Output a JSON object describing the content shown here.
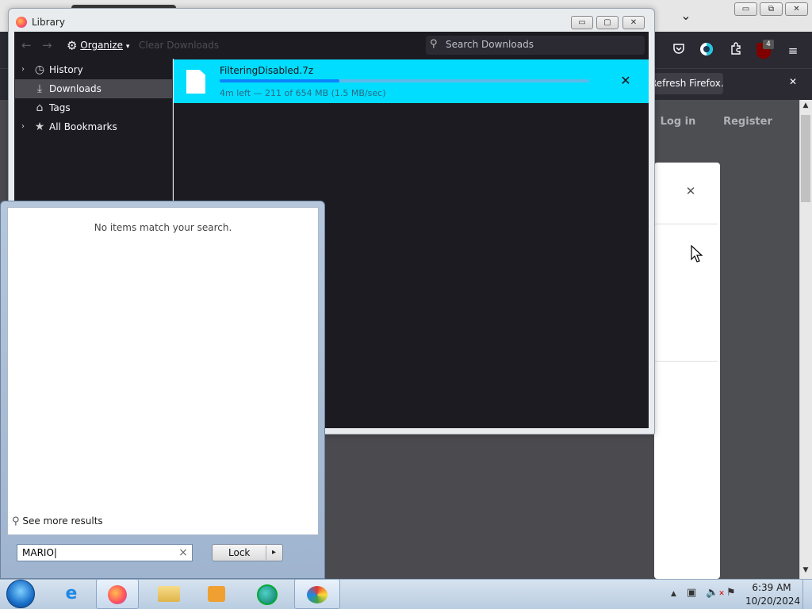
{
  "library": {
    "title": "Library",
    "organize_label": "Organize",
    "organize_arrow": "▾",
    "clear_label": "Clear Downloads",
    "search_placeholder": "Search Downloads",
    "sidebar": [
      {
        "label": "History",
        "icon": "clock-icon",
        "expander": "›"
      },
      {
        "label": "Downloads",
        "icon": "download-icon",
        "expander": ""
      },
      {
        "label": "Tags",
        "icon": "tag-icon",
        "expander": ""
      },
      {
        "label": "All Bookmarks",
        "icon": "star-icon",
        "expander": "›"
      }
    ],
    "download": {
      "filename": "FilteringDisabled.7z",
      "status": "4m left — 211 of 654 MB (1.5 MB/sec)",
      "progress": 0.323,
      "close_glyph": "✕"
    }
  },
  "firefox": {
    "notification_button": "Refresh Firefox…",
    "notification_close": "✕",
    "login_label": "Log in",
    "register_label": "Register",
    "dialog_close": "✕",
    "tabs_dropdown": "⌄",
    "extension_badge": "4"
  },
  "start_menu": {
    "no_results": "No items match your search.",
    "see_more": "See more results",
    "search_value": "MARIO",
    "clear_glyph": "×",
    "lock_label": "Lock",
    "lock_arrow": "▸"
  },
  "tray": {
    "time": "6:39 AM",
    "date": "10/20/2024"
  },
  "colors": {
    "download_highlight": "#00ddff",
    "firefox_dark": "#1c1b22",
    "taskbar": "#b9cde1"
  }
}
